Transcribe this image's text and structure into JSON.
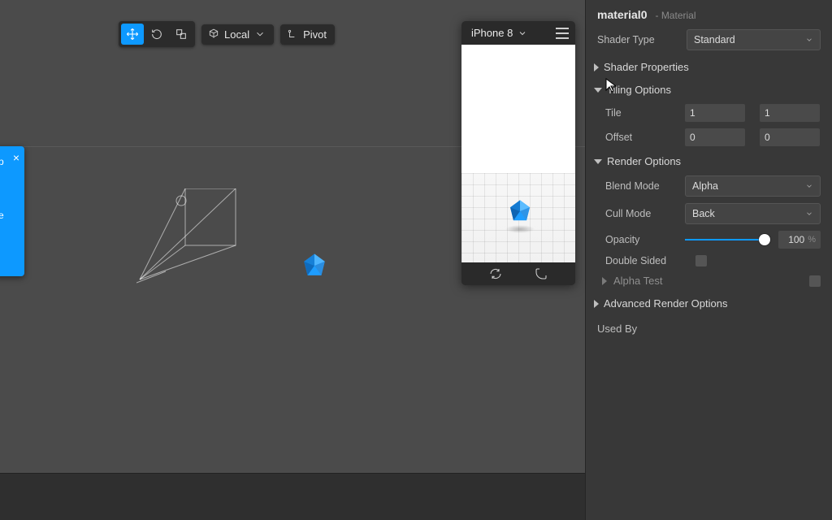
{
  "toolbar": {
    "move_tooltip": "Move",
    "rotate_tooltip": "Rotate",
    "scale_tooltip": "Scale",
    "space_label": "Local",
    "pivot_label": "Pivot"
  },
  "blue_card": {
    "line1": "p",
    "line2": "l",
    "line3": "e"
  },
  "device": {
    "name": "iPhone 8",
    "refresh_tooltip": "Refresh",
    "rotate_tooltip": "Rotate"
  },
  "inspector": {
    "title": "material0",
    "subtitle": "- Material",
    "shader_type_label": "Shader Type",
    "shader_type_value": "Standard",
    "sections": {
      "shader_props": "Shader Properties",
      "tiling": "Tiling Options",
      "render": "Render Options",
      "alpha_test": "Alpha Test",
      "advanced": "Advanced Render Options",
      "used_by": "Used By"
    },
    "tiling": {
      "tile_label": "Tile",
      "tile_x": "1",
      "tile_y": "1",
      "offset_label": "Offset",
      "offset_x": "0",
      "offset_y": "0"
    },
    "render": {
      "blend_label": "Blend Mode",
      "blend_value": "Alpha",
      "cull_label": "Cull Mode",
      "cull_value": "Back",
      "opacity_label": "Opacity",
      "opacity_value": "100",
      "opacity_unit": "%",
      "double_sided_label": "Double Sided"
    }
  }
}
